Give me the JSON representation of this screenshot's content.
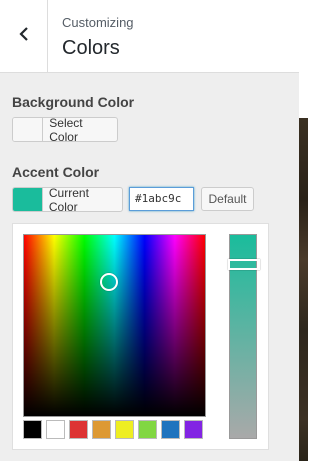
{
  "header": {
    "breadcrumb": "Customizing",
    "title": "Colors",
    "back_icon": "chevron-left-icon"
  },
  "background_color": {
    "label": "Background Color",
    "button_text": "Select Color",
    "swatch_color": "#f7f7f7"
  },
  "accent_color": {
    "label": "Accent Color",
    "button_text": "Current Color",
    "swatch_color": "#1abc9c",
    "hex_value": "#1abc9c",
    "default_label": "Default"
  },
  "picker": {
    "selected_hex": "#1abc9c",
    "palette": [
      "#000000",
      "#ffffff",
      "#dd3333",
      "#dd9933",
      "#eeee22",
      "#81d742",
      "#1e73be",
      "#8224e3"
    ]
  }
}
